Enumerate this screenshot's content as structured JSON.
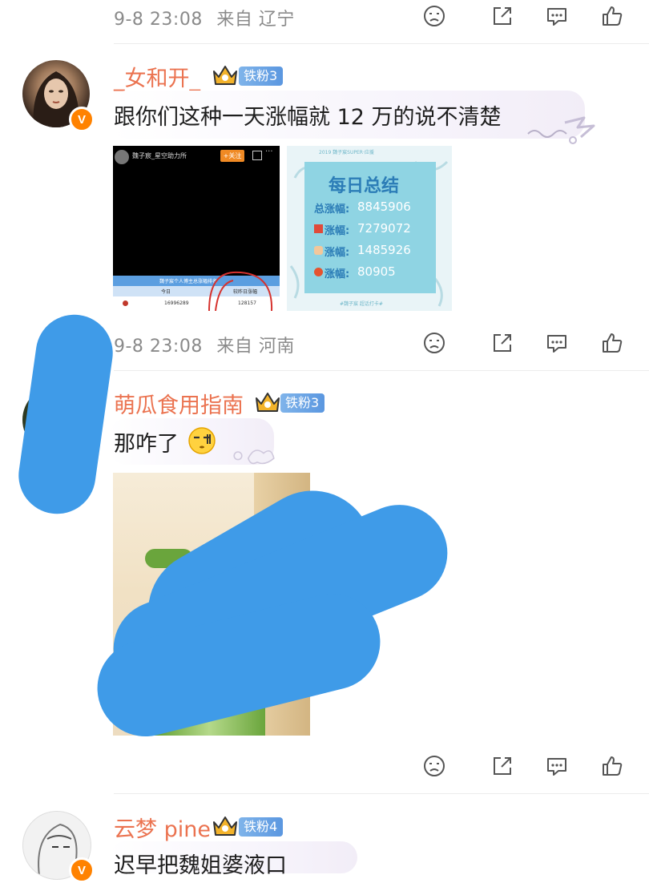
{
  "comments": [
    {
      "time": "9-8 23:08",
      "location_prefix": "来自",
      "location": "辽宁"
    },
    {
      "time": "9-8 23:08",
      "location_prefix": "来自",
      "location": "河南"
    },
    {
      "time": "",
      "location_prefix": "",
      "location": ""
    }
  ],
  "comment1": {
    "username": "_女和开_",
    "fan_badge": "铁粉3",
    "text": "跟你们这种一天涨幅就 12 万的说不清楚",
    "image_left": {
      "account": "魏子宸_星空助力所",
      "follow_label": "+关注",
      "more_label": "···",
      "table_title": "魏子宸个人博主总涨幅排名",
      "col_today": "今日",
      "col_yesterday": "较昨日涨幅",
      "val_today": "16996289",
      "val_change": "128157"
    },
    "image_right": {
      "header": "2019 魏子宸SUPER·应援",
      "title": "每日总结",
      "rows": [
        {
          "label": "总涨幅:",
          "value": "8845906"
        },
        {
          "label": "涨幅:",
          "value": "7279072"
        },
        {
          "label": "涨幅:",
          "value": "1485926"
        },
        {
          "label": "涨幅:",
          "value": "80905"
        }
      ],
      "footer": "#魏子宸 超话打卡#"
    }
  },
  "comment2": {
    "username": "萌瓜食用指南",
    "fan_badge": "铁粉3",
    "text": "那咋了"
  },
  "comment3": {
    "username": "云梦 pine",
    "fan_badge": "铁粉4",
    "text": "迟早把魏姐婆液口"
  },
  "colors": {
    "username": "#eb7350",
    "meta": "#8a8a8a",
    "fan_badge": "#6aa6e6",
    "redaction": "#3f9be8",
    "v_badge": "#ff8200"
  },
  "icons": [
    "dislike-face-icon",
    "share-icon",
    "comment-icon",
    "like-icon"
  ]
}
